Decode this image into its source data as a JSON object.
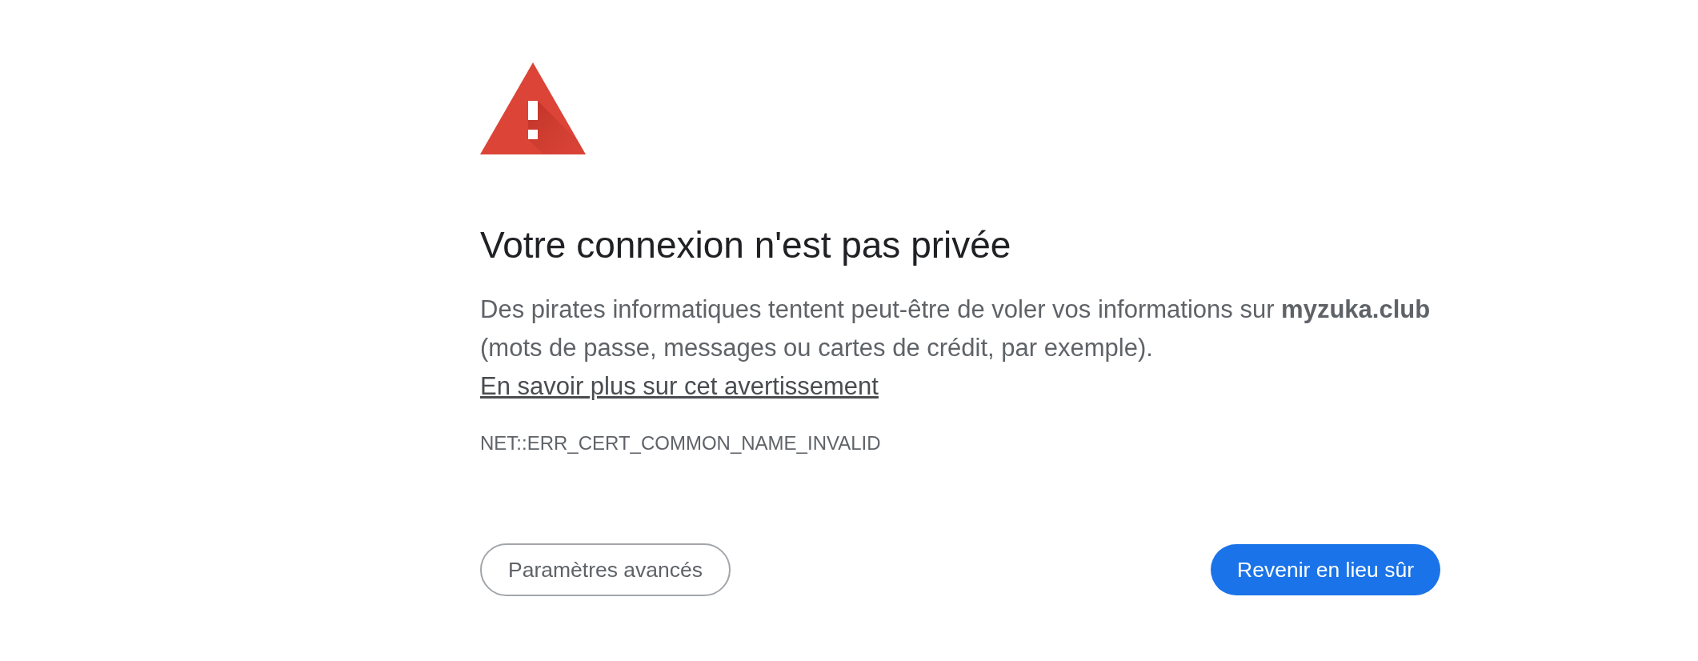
{
  "heading": "Votre connexion n'est pas privée",
  "message": {
    "text": "Des pirates informatiques tentent peut-être de voler vos informations sur **myzuka.club** (mots de passe, messages ou cartes de crédit, par exemple).",
    "link": "En savoir plus sur cet avertissement"
  },
  "error_code": "NET::ERR_CERT_COMMON_NAME_INVALID",
  "buttons": [
    {
      "label": "Paramètres avancés",
      "kind": "secondary"
    },
    {
      "label": "Revenir en lieu sûr",
      "kind": "primary"
    }
  ]
}
